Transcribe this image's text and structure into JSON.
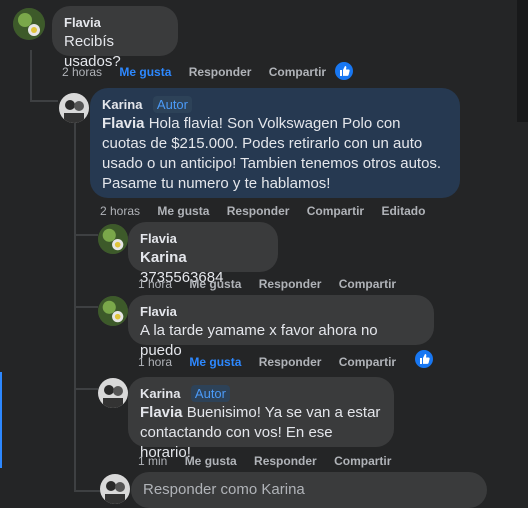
{
  "colors": {
    "background": "#242526",
    "bubble": "#3a3b3c",
    "highlight_bubble": "#263951",
    "accent": "#2d88ff",
    "muted": "#b0b3b8"
  },
  "comments": [
    {
      "author": "Flavia",
      "text": "Recibís usados?",
      "time": "2 horas",
      "like_label": "Me gusta",
      "reply_label": "Responder",
      "share_label": "Compartir",
      "liked": true
    },
    {
      "author": "Karina",
      "badge": "Autor",
      "mention": "Flavia",
      "text": " Hola flavia! Son Volkswagen Polo con cuotas de $215.000. Podes retirarlo con un auto usado o un anticipo! Tambien tenemos otros autos. Pasame tu numero y te hablamos!",
      "time": "2 horas",
      "like_label": "Me gusta",
      "reply_label": "Responder",
      "share_label": "Compartir",
      "edited_label": "Editado"
    },
    {
      "author": "Flavia",
      "mention": "Karina",
      "text": " 3735563684",
      "time": "1 hora",
      "like_label": "Me gusta",
      "reply_label": "Responder",
      "share_label": "Compartir"
    },
    {
      "author": "Flavia",
      "text": "A la tarde yamame x favor ahora no puedo",
      "time": "1 hora",
      "like_label": "Me gusta",
      "reply_label": "Responder",
      "share_label": "Compartir",
      "liked": true
    },
    {
      "author": "Karina",
      "badge": "Autor",
      "mention": "Flavia",
      "text": " Buenisimo! Ya se van a estar contactando con vos! En ese horario!",
      "time": "1 min",
      "like_label": "Me gusta",
      "reply_label": "Responder",
      "share_label": "Compartir"
    }
  ],
  "reply_placeholder": "Responder como Karina"
}
